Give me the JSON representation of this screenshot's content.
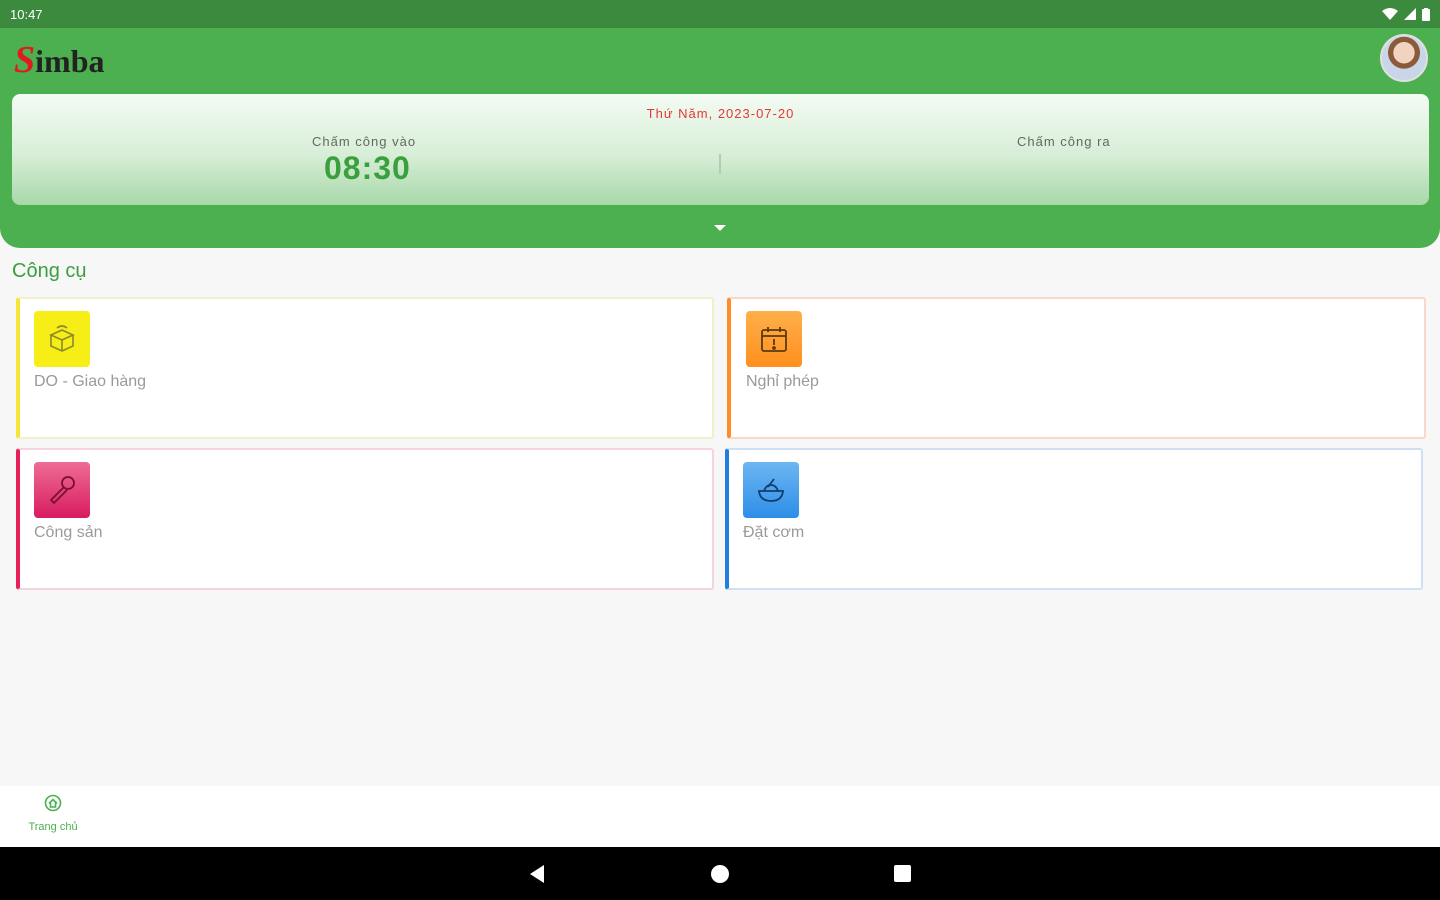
{
  "status_bar": {
    "time": "10:47",
    "icons": [
      "wifi-icon",
      "signal-icon",
      "battery-icon"
    ]
  },
  "header": {
    "logo_initial": "S",
    "logo_rest": "imba",
    "avatar": "avatar"
  },
  "attendance": {
    "date": "Thứ Năm, 2023-07-20",
    "check_in_label": "Chấm công vào",
    "check_in_time": "08:30",
    "check_out_label": "Chấm công ra"
  },
  "tools": {
    "section_title": "Công cụ",
    "items": [
      {
        "label": "DO - Giao hàng",
        "icon": "box-delivery-icon",
        "color": "#f6ee16",
        "accent": "#f6e53a"
      },
      {
        "label": "Nghỉ phép",
        "icon": "calendar-alert-icon",
        "color": "#ff9a2a",
        "accent": "#ff8c26"
      },
      {
        "label": "Công sản",
        "icon": "wrench-icon",
        "color": "#e8447a",
        "accent": "#e72058"
      },
      {
        "label": "Đặt cơm",
        "icon": "rice-bowl-icon",
        "color": "#4aa3ee",
        "accent": "#1e7fe0"
      }
    ]
  },
  "bottom_nav": {
    "home_label": "Trang chủ"
  },
  "colors": {
    "primary": "#4caf50",
    "status_bar": "#3c8a3e",
    "date_red": "#e53935"
  }
}
